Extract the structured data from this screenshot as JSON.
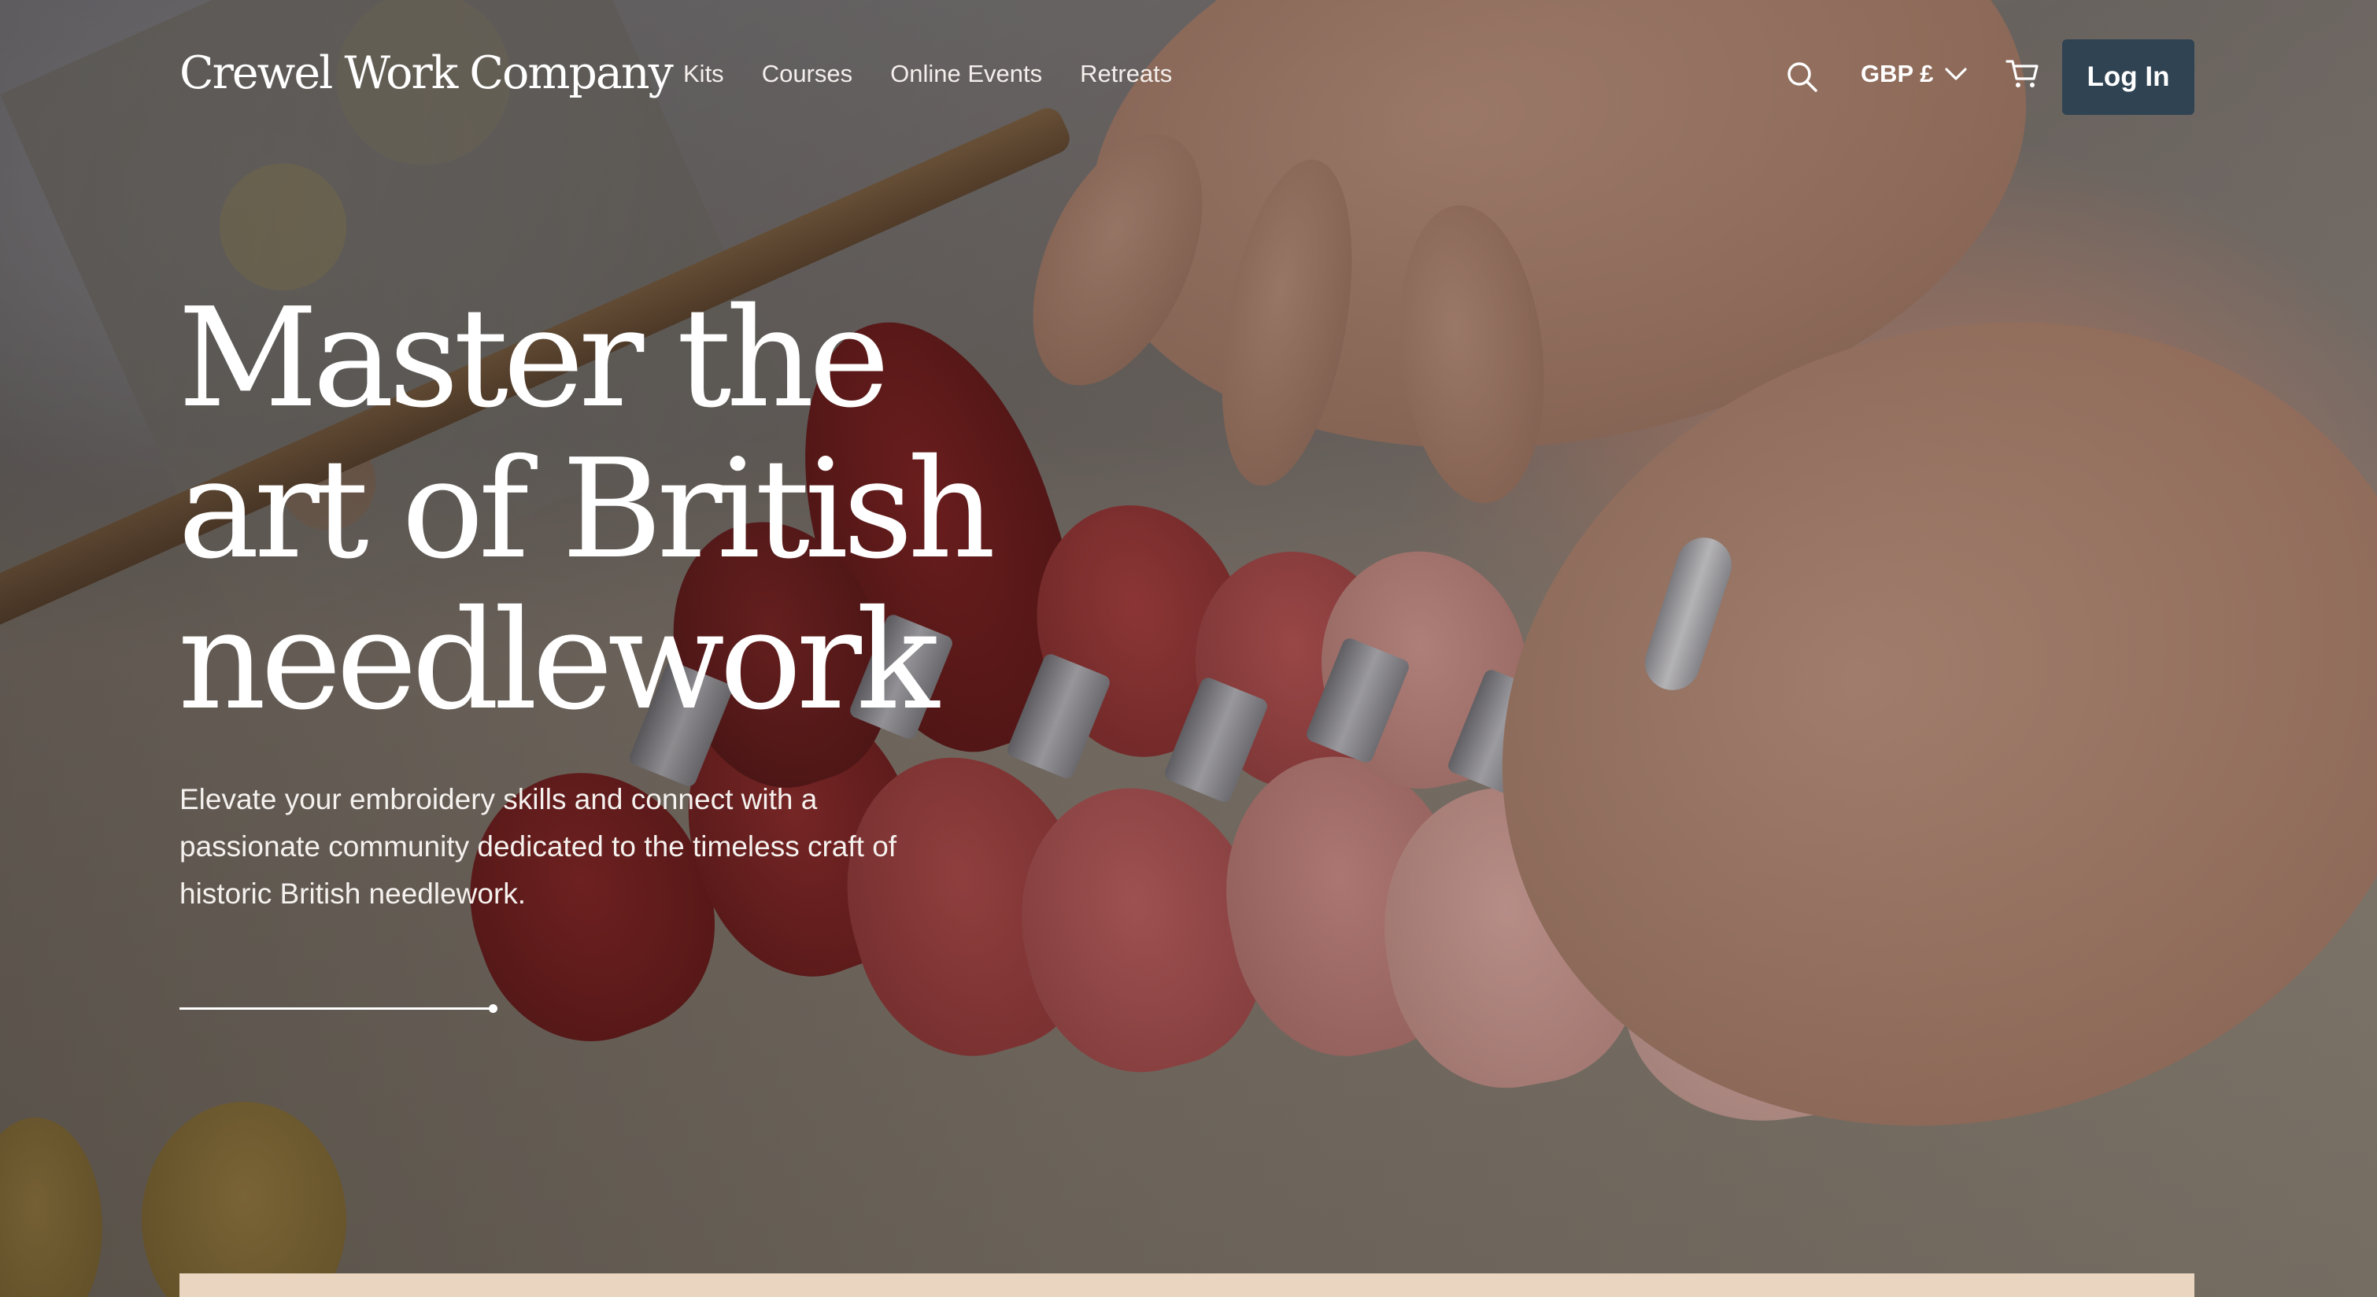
{
  "brand": {
    "name": "Crewel Work Company"
  },
  "nav": {
    "items": [
      {
        "label": "Kits"
      },
      {
        "label": "Courses"
      },
      {
        "label": "Online Events"
      },
      {
        "label": "Retreats"
      }
    ]
  },
  "header": {
    "search_icon": "search-icon",
    "currency_label": "GBP £",
    "currency_icon": "chevron-down-icon",
    "cart_icon": "cart-icon",
    "login_label": "Log In"
  },
  "hero": {
    "headline_lines": [
      "Master the",
      "art of British",
      "needlework"
    ],
    "subcopy_lines": [
      "Elevate your embroidery skills and connect with a",
      "passionate community dedicated to the timeless craft of",
      "historic British needlework."
    ],
    "slide_progress": 1.0
  },
  "colors": {
    "login_button": "#2f4352",
    "strip": "#ead6c0",
    "text": "#ffffff"
  }
}
